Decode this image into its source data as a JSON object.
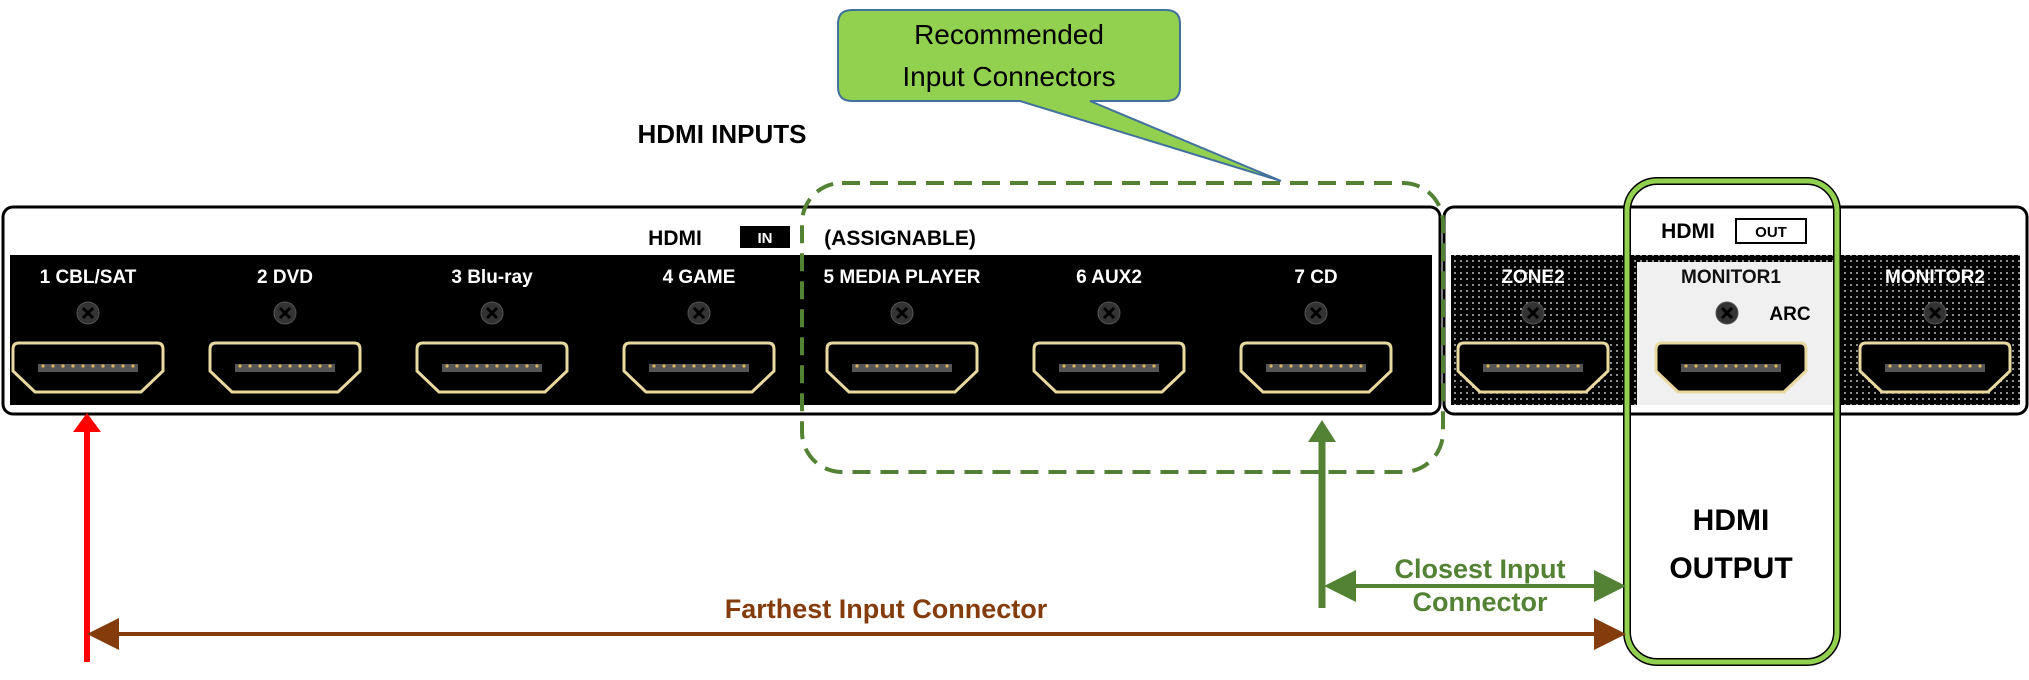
{
  "callout": {
    "line1": "Recommended",
    "line2": "Input Connectors"
  },
  "inputs_heading": "HDMI INPUTS",
  "input_panel": {
    "hdmi": "HDMI",
    "in_badge": "IN",
    "assignable": "(ASSIGNABLE)",
    "ports": [
      "1 CBL/SAT",
      "2 DVD",
      "3 Blu-ray",
      "4 GAME",
      "5 MEDIA PLAYER",
      "6 AUX2",
      "7 CD"
    ]
  },
  "output_panel": {
    "hdmi": "HDMI",
    "out_badge": "OUT",
    "ports": [
      "ZONE2",
      "MONITOR1",
      "MONITOR2"
    ],
    "arc": "ARC"
  },
  "output_label": {
    "line1": "HDMI",
    "line2": "OUTPUT"
  },
  "farthest": "Farthest Input Connector",
  "closest": {
    "line1": "Closest Input",
    "line2": "Connector"
  },
  "colors": {
    "red": "#ff0000",
    "brown": "#843c0c",
    "green": "#548235",
    "lime": "#92d050",
    "gold": "#e8d9a0"
  }
}
